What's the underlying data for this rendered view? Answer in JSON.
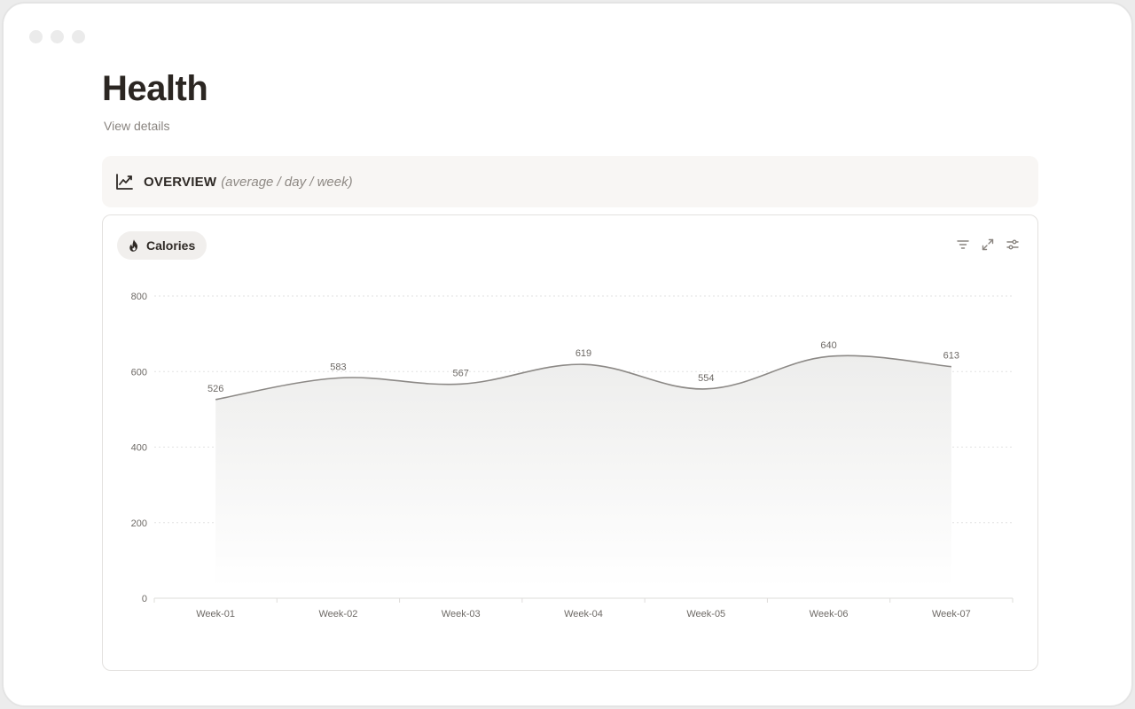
{
  "page": {
    "title": "Health",
    "view_details": "View details"
  },
  "overview": {
    "label": "OVERVIEW",
    "subtitle": "(average / day / week)",
    "icon": "trend-line-icon"
  },
  "card": {
    "metric": {
      "label": "Calories",
      "icon": "flame-icon"
    },
    "tools": [
      {
        "name": "filter-icon"
      },
      {
        "name": "expand-icon"
      },
      {
        "name": "sliders-icon"
      }
    ]
  },
  "colors": {
    "line": "#8c8986",
    "area_top": "#ededec",
    "grid": "#e2e2e2",
    "axis_text": "#6e6a66"
  },
  "chart_data": {
    "type": "area",
    "categories": [
      "Week-01",
      "Week-02",
      "Week-03",
      "Week-04",
      "Week-05",
      "Week-06",
      "Week-07"
    ],
    "series": [
      {
        "values": [
          526,
          583,
          567,
          619,
          554,
          640,
          613
        ]
      }
    ],
    "ylim": [
      0,
      800
    ],
    "yticks": [
      0,
      200,
      400,
      600,
      800
    ],
    "grid": true,
    "data_labels": true,
    "curve": "smooth"
  }
}
